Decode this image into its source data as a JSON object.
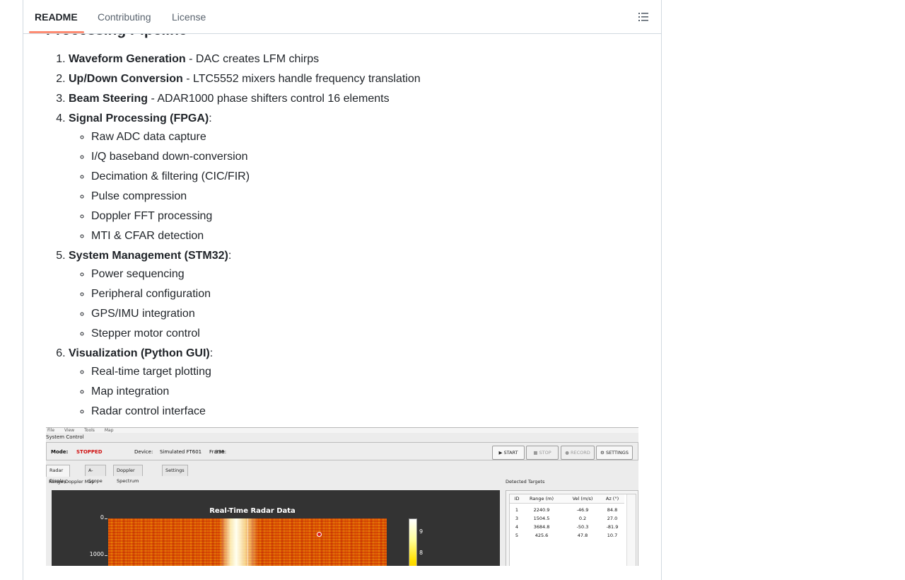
{
  "tabs": [
    {
      "label": "README",
      "active": true
    },
    {
      "label": "Contributing",
      "active": false
    },
    {
      "label": "License",
      "active": false
    }
  ],
  "outline_icon": "list-outline-icon",
  "section_heading": "Processing Pipeline",
  "pipeline": [
    {
      "title": "Waveform Generation",
      "desc": " - DAC creates LFM chirps"
    },
    {
      "title": "Up/Down Conversion",
      "desc": " - LTC5552 mixers handle frequency translation"
    },
    {
      "title": "Beam Steering",
      "desc": " - ADAR1000 phase shifters control 16 elements"
    },
    {
      "title": "Signal Processing (FPGA)",
      "desc": ":",
      "subitems": [
        "Raw ADC data capture",
        "I/Q baseband down-conversion",
        "Decimation & filtering (CIC/FIR)",
        "Pulse compression",
        "Doppler FFT processing",
        "MTI & CFAR detection"
      ]
    },
    {
      "title": "System Management (STM32)",
      "desc": ":",
      "subitems": [
        "Power sequencing",
        "Peripheral configuration",
        "GPS/IMU integration",
        "Stepper motor control"
      ]
    },
    {
      "title": "Visualization (Python GUI)",
      "desc": ":",
      "subitems": [
        "Real-time target plotting",
        "Map integration",
        "Radar control interface"
      ]
    }
  ],
  "gui_screenshot": {
    "menu": [
      "File",
      "View",
      "Tools",
      "Map"
    ],
    "system_control_label": "System Control",
    "mode_label": "Mode:",
    "mode_value": "STOPPED",
    "device_label": "Device:",
    "device_value": "Simulated FT601",
    "frame_label": "Frame:",
    "frame_value": "336",
    "buttons": {
      "start": "▶ START",
      "stop": "■ STOP",
      "record": "● RECORD",
      "settings": "⚙ SETTINGS"
    },
    "subtabs": [
      "Radar Display",
      "A-Scope",
      "Doppler Spectrum",
      "Settings"
    ],
    "map_panel_title": "Range-Doppler Map",
    "plot_title": "Real-Time Radar Data",
    "y_ticks": [
      "0",
      "1000"
    ],
    "colorbar_ticks": [
      "9",
      "8"
    ],
    "targets_panel_title": "Detected Targets",
    "target_columns": [
      "ID",
      "Range (m)",
      "Vel (m/s)",
      "Az (°)"
    ],
    "targets": [
      [
        "1",
        "2240.9",
        "-46.9",
        "84.8"
      ],
      [
        "3",
        "1504.5",
        "0.2",
        "27.0"
      ],
      [
        "4",
        "3684.8",
        "-50.3",
        "-81.9"
      ],
      [
        "5",
        "425.6",
        "47.8",
        "10.7"
      ]
    ],
    "mode_color": "#d01010"
  }
}
